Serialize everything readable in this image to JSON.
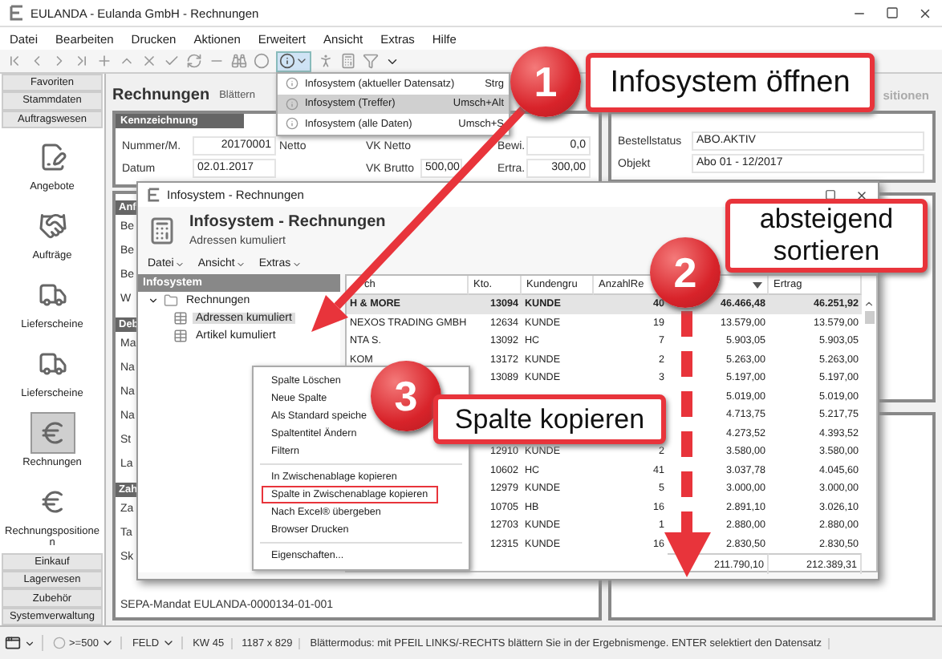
{
  "window": {
    "title": "EULANDA - Eulanda GmbH - Rechnungen"
  },
  "menu": [
    "Datei",
    "Bearbeiten",
    "Drucken",
    "Aktionen",
    "Erweitert",
    "Ansicht",
    "Extras",
    "Hilfe"
  ],
  "sidebar": {
    "groups_top": [
      "Favoriten",
      "Stammdaten",
      "Auftragswesen"
    ],
    "items": [
      {
        "label": "Angebote",
        "kind": "quote",
        "selected": false
      },
      {
        "label": "Aufträge",
        "kind": "order",
        "selected": false
      },
      {
        "label": "Lieferscheine",
        "kind": "truck",
        "selected": false
      },
      {
        "label": "Lieferscheine",
        "kind": "truck",
        "selected": false
      },
      {
        "label": "Rechnungen",
        "kind": "invoice",
        "selected": true
      },
      {
        "label": "Rechnungspositionen",
        "kind": "invoice",
        "selected": false
      }
    ],
    "groups_bottom": [
      "Einkauf",
      "Lagerwesen",
      "Zubehör",
      "Systemverwaltung"
    ]
  },
  "page": {
    "title": "Rechnungen",
    "mode": "Blättern",
    "side_tab": "sitionen"
  },
  "ident": {
    "header": "Kennzeichnung",
    "fields": [
      {
        "label": "Nummer/M.",
        "value": "20170001"
      },
      {
        "label": "Datum",
        "value": "02.01.2017"
      }
    ],
    "netto_label": "Netto",
    "amounts": [
      {
        "label": "VK Netto"
      },
      {
        "label": "VK Brutto",
        "value": "500,00"
      }
    ],
    "extra": [
      {
        "label": "Bewi.",
        "value": "0,0"
      },
      {
        "label": "Ertra.",
        "value": "300,00"
      }
    ]
  },
  "order": {
    "fields": [
      {
        "label": "Bestellstatus",
        "value": "ABO.AKTIV"
      },
      {
        "label": "Objekt",
        "value": "Abo 01 - 12/2017"
      }
    ]
  },
  "strip": [
    {
      "kind": "header",
      "text": "Anf"
    },
    {
      "kind": "label",
      "text": "Be"
    },
    {
      "kind": "label",
      "text": "Be"
    },
    {
      "kind": "label",
      "text": "Be"
    },
    {
      "kind": "label",
      "text": "W"
    },
    {
      "kind": "header",
      "text": "Deb"
    },
    {
      "kind": "label",
      "text": "Ma"
    },
    {
      "kind": "label",
      "text": "Na"
    },
    {
      "kind": "label",
      "text": "Na"
    },
    {
      "kind": "label",
      "text": "Na"
    },
    {
      "kind": "label",
      "text": "St"
    },
    {
      "kind": "label",
      "text": "La"
    },
    {
      "kind": "header",
      "text": "Zah"
    },
    {
      "kind": "label",
      "text": "Za"
    },
    {
      "kind": "label",
      "text": "Ta"
    },
    {
      "kind": "label",
      "text": "Sk"
    },
    {
      "kind": "footnote",
      "text": "SEPA-Mandat  EULANDA-0000134-01-001"
    }
  ],
  "dropdown": [
    {
      "label": "Infosystem (aktueller Datensatz)",
      "shortcut": "Strg",
      "selected": false
    },
    {
      "label": "Infosystem (Treffer)",
      "shortcut": "Umsch+Alt",
      "selected": true
    },
    {
      "label": "Infosystem (alle Daten)",
      "shortcut": "Umsch+S",
      "selected": false
    }
  ],
  "infosystem": {
    "title": "Infosystem - Rechnungen",
    "heading": "Infosystem - Rechnungen",
    "subheading": "Adressen kumuliert",
    "menu": [
      "Datei",
      "Ansicht",
      "Extras"
    ],
    "tree": {
      "header": "Infosystem",
      "items": [
        {
          "label": "Rechnungen",
          "expanded": true,
          "children": [
            {
              "label": "Adressen kumuliert",
              "selected": true
            },
            {
              "label": "Artikel kumuliert",
              "selected": false
            }
          ]
        }
      ]
    },
    "grid": {
      "columns": [
        {
          "label": "ch",
          "sorted": false
        },
        {
          "label": "Kto.",
          "sorted": false
        },
        {
          "label": "Kundengru",
          "sorted": false
        },
        {
          "label": "AnzahlRe",
          "sorted": false
        },
        {
          "sorted": true
        },
        {
          "label": "Ertrag",
          "sorted": false
        }
      ],
      "rows": [
        {
          "selected": true,
          "name": "H & MORE",
          "kto": "13094",
          "group": "KUNDE",
          "count": "40",
          "sum": "46.466,48",
          "ertrag": "46.251,92"
        },
        {
          "selected": false,
          "name": "NEXOS TRADING GMBH",
          "kto": "12634",
          "group": "KUNDE",
          "count": "19",
          "sum": "13.579,00",
          "ertrag": "13.579,00"
        },
        {
          "selected": false,
          "name": "NTA S.",
          "kto": "13092",
          "group": "HC",
          "count": "7",
          "sum": "5.903,05",
          "ertrag": "5.903,05"
        },
        {
          "selected": false,
          "name": "KOM",
          "kto": "13172",
          "group": "KUNDE",
          "count": "2",
          "sum": "5.263,00",
          "ertrag": "5.263,00"
        },
        {
          "selected": false,
          "kto": "13089",
          "group": "KUNDE",
          "count": "3",
          "sum": "5.197,00",
          "ertrag": "5.197,00"
        },
        {
          "selected": false,
          "sum": "5.019,00",
          "ertrag": "5.019,00"
        },
        {
          "selected": false,
          "sum": "4.713,75",
          "ertrag": "5.217,75"
        },
        {
          "selected": false,
          "sum": "4.273,52",
          "ertrag": "4.393,52"
        },
        {
          "selected": false,
          "kto": "12910",
          "group": "KUNDE",
          "count": "2",
          "sum": "3.580,00",
          "ertrag": "3.580,00"
        },
        {
          "selected": false,
          "kto": "10602",
          "group": "HC",
          "count": "41",
          "sum": "3.037,78",
          "ertrag": "4.045,60"
        },
        {
          "selected": false,
          "kto": "12979",
          "group": "KUNDE",
          "count": "5",
          "sum": "3.000,00",
          "ertrag": "3.000,00"
        },
        {
          "selected": false,
          "kto": "10705",
          "group": "HB",
          "count": "16",
          "sum": "2.891,10",
          "ertrag": "3.026,10"
        },
        {
          "selected": false,
          "kto": "12703",
          "group": "KUNDE",
          "count": "1",
          "sum": "2.880,00",
          "ertrag": "2.880,00"
        },
        {
          "selected": false,
          "kto": "12315",
          "group": "KUNDE",
          "count": "16",
          "sum": "2.830,50",
          "ertrag": "2.830,50"
        }
      ],
      "totals": {
        "sum": "211.790,10",
        "ertrag": "212.389,31"
      }
    }
  },
  "context_menu": [
    {
      "kind": "item",
      "label": "Spalte Löschen",
      "highlighted": false
    },
    {
      "kind": "item",
      "label": "Neue Spalte",
      "highlighted": false
    },
    {
      "kind": "item",
      "label": "Als Standard speiche",
      "highlighted": false
    },
    {
      "kind": "item",
      "label": "Spaltentitel Ändern",
      "highlighted": false
    },
    {
      "kind": "item",
      "label": "Filtern",
      "highlighted": false
    },
    {
      "kind": "separator"
    },
    {
      "kind": "item",
      "label": "In Zwischenablage kopieren",
      "highlighted": false
    },
    {
      "kind": "item",
      "label": "Spalte in Zwischenablage kopieren",
      "highlighted": true
    },
    {
      "kind": "item",
      "label": "Nach Excel® übergeben",
      "highlighted": false
    },
    {
      "kind": "item",
      "label": "Browser Drucken",
      "highlighted": false
    },
    {
      "kind": "separator"
    },
    {
      "kind": "item",
      "label": "Eigenschaften...",
      "highlighted": false
    }
  ],
  "callouts": [
    {
      "number": "1",
      "text": "Infosystem öffnen"
    },
    {
      "number": "2",
      "text": "absteigend sortieren"
    },
    {
      "number": "3",
      "text": "Spalte kopieren"
    }
  ],
  "status_bar": {
    "limit": ">=500",
    "field": "FELD",
    "week": "KW 45",
    "size": "1187 x 829",
    "message": "Blättermodus: mit PFEIL LINKS/-RECHTS blättern Sie in der Ergebnismenge. ENTER selektiert den Datensatz"
  }
}
